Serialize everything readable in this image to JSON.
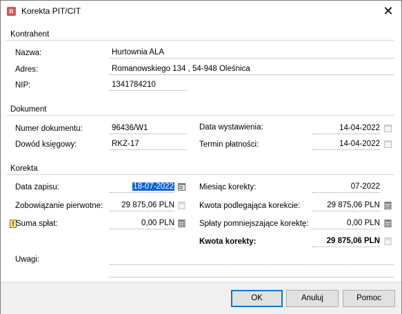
{
  "window": {
    "title": "Korekta PIT/CIT",
    "close_glyph": "✕"
  },
  "kontrahent": {
    "heading": "Kontrahent",
    "nazwa_label": "Nazwa:",
    "nazwa": "Hurtownia ALA",
    "adres_label": "Adres:",
    "adres": "Romanowskiego 134 , 54-948 Oleśnica",
    "nip_label": "NIP:",
    "nip": "1341784210"
  },
  "dokument": {
    "heading": "Dokument",
    "numer_label": "Numer dokumentu:",
    "numer": "96436/W1",
    "dowod_label": "Dowód księgowy:",
    "dowod": "RKZ-17",
    "data_wyst_label": "Data wystawienia:",
    "data_wyst": "14-04-2022",
    "termin_label": "Termin płatności:",
    "termin": "14-04-2022"
  },
  "korekta": {
    "heading": "Korekta",
    "data_zapisu_label": "Data zapisu:",
    "data_zapisu": "18-07-2022",
    "zobowiazanie_label": "Zobowiązanie pierwotne:",
    "zobowiazanie": "29 875,06 PLN",
    "suma_label": "Suma spłat:",
    "suma": "0,00 PLN",
    "miesiac_label": "Miesiąc korekty:",
    "miesiac": "07-2022",
    "kwota_podl_label": "Kwota podlegająca korekcie:",
    "kwota_podl": "29 875,06 PLN",
    "splaty_label": "Spłaty pomniejszające korektę:",
    "splaty": "0,00 PLN",
    "kwota_kor_label": "Kwota korekty:",
    "kwota_kor": "29 875,06 PLN",
    "uwagi_label": "Uwagi:",
    "uwagi": ""
  },
  "buttons": {
    "ok": "OK",
    "anuluj": "Anuluj",
    "pomoc": "Pomoc"
  },
  "colors": {
    "selection": "#0a64d8",
    "default_button_border": "#0078d7",
    "footer_bg": "#f0f0f0"
  }
}
